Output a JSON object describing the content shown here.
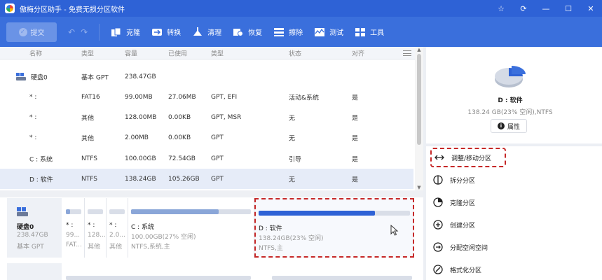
{
  "window": {
    "title": "傲梅分区助手 - 免费无损分区软件",
    "controls": [
      "☆",
      "⟳",
      "—",
      "☐",
      "✕"
    ]
  },
  "toolbar": {
    "submit_label": "提交",
    "tools": [
      {
        "label": "克隆",
        "icon": "clone-icon"
      },
      {
        "label": "转换",
        "icon": "convert-icon"
      },
      {
        "label": "清理",
        "icon": "clean-icon"
      },
      {
        "label": "恢复",
        "icon": "recover-icon"
      },
      {
        "label": "擦除",
        "icon": "wipe-icon"
      },
      {
        "label": "测试",
        "icon": "test-icon"
      },
      {
        "label": "工具",
        "icon": "tools-icon"
      }
    ]
  },
  "table": {
    "headers": [
      "名称",
      "类型",
      "容量",
      "已使用",
      "类型",
      "状态",
      "对齐"
    ],
    "rows": [
      {
        "name": "硬盘0",
        "type": "基本 GPT",
        "capacity": "238.47GB",
        "used": "",
        "fs": "",
        "status": "",
        "align": "",
        "is_disk": true
      },
      {
        "name": "* :",
        "type": "FAT16",
        "capacity": "99.00MB",
        "used": "27.06MB",
        "fs": "GPT, EFI",
        "status": "活动&系统",
        "align": "是"
      },
      {
        "name": "* :",
        "type": "其他",
        "capacity": "128.00MB",
        "used": "0.00KB",
        "fs": "GPT, MSR",
        "status": "无",
        "align": "是"
      },
      {
        "name": "* :",
        "type": "其他",
        "capacity": "2.00MB",
        "used": "0.00KB",
        "fs": "GPT",
        "status": "无",
        "align": "是"
      },
      {
        "name": "C : 系统",
        "type": "NTFS",
        "capacity": "100.00GB",
        "used": "72.54GB",
        "fs": "GPT",
        "status": "引导",
        "align": "是"
      },
      {
        "name": "D : 软件",
        "type": "NTFS",
        "capacity": "138.24GB",
        "used": "105.26GB",
        "fs": "GPT",
        "status": "无",
        "align": "是",
        "selected": true
      }
    ]
  },
  "diskmap": {
    "disk": {
      "title": "硬盘0",
      "size": "238.47GB",
      "type": "基本 GPT"
    },
    "partitions": [
      {
        "t1": "* :",
        "t2": "99...",
        "t3": "FAT...",
        "used_fraction": 0.27
      },
      {
        "t1": "* :",
        "t2": "128...",
        "t3": "其他",
        "used_fraction": 0.0
      },
      {
        "t1": "* :",
        "t2": "2.0...",
        "t3": "其他",
        "used_fraction": 0.0
      },
      {
        "t1": "C : 系统",
        "t2": "100.00GB(27% 空闲)",
        "t3": "NTFS,系统,主",
        "used_fraction": 0.73
      },
      {
        "t1": "D : 软件",
        "t2": "138.24GB(23% 空闲)",
        "t3": "NTFS,主",
        "used_fraction": 0.77,
        "selected": true
      }
    ]
  },
  "right_panel": {
    "title": "D : 软件",
    "subtitle": "138.24 GB(23% 空闲),NTFS",
    "properties_label": "属性",
    "actions": [
      {
        "label": "调整/移动分区",
        "icon": "resize-move-icon",
        "highlighted": true
      },
      {
        "label": "拆分分区",
        "icon": "split-icon"
      },
      {
        "label": "克隆分区",
        "icon": "clone-partition-icon"
      },
      {
        "label": "创建分区",
        "icon": "create-partition-icon"
      },
      {
        "label": "分配空闲空间",
        "icon": "allocate-space-icon"
      },
      {
        "label": "格式化分区",
        "icon": "format-icon"
      }
    ]
  },
  "colors": {
    "titlebar": "#2e62d6",
    "toolbar": "#3a6fdc",
    "selection_border": "#c62828",
    "selected_row": "#e6ecf8"
  }
}
